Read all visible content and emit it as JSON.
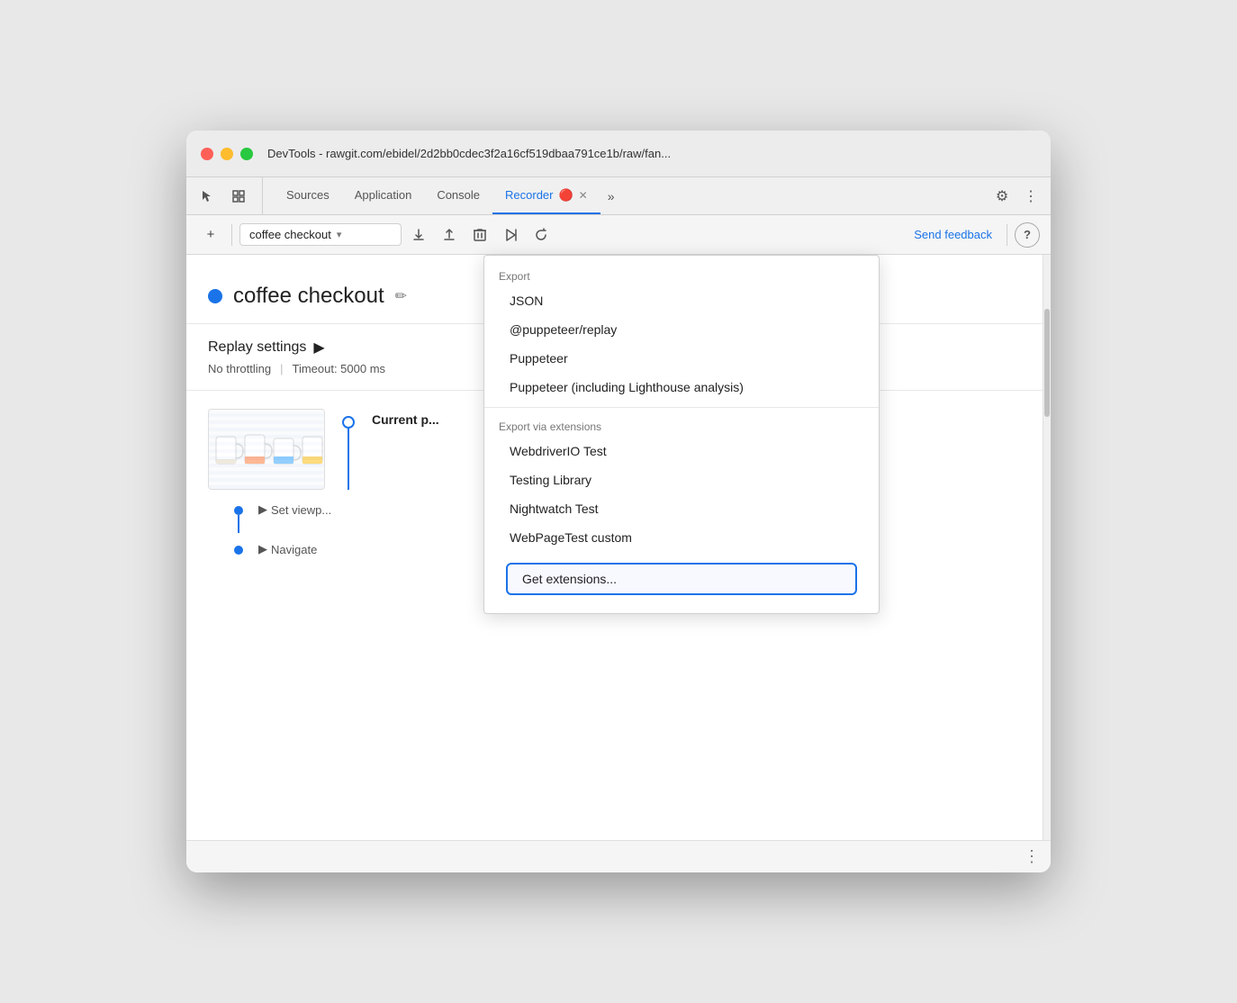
{
  "window": {
    "title": "DevTools - rawgit.com/ebidel/2d2bb0cdec3f2a16cf519dbaa791ce1b/raw/fan...",
    "traffic_lights": [
      "red",
      "yellow",
      "green"
    ]
  },
  "tabs": [
    {
      "id": "sources",
      "label": "Sources",
      "active": false
    },
    {
      "id": "application",
      "label": "Application",
      "active": false
    },
    {
      "id": "console",
      "label": "Console",
      "active": false
    },
    {
      "id": "recorder",
      "label": "Recorder",
      "active": true,
      "closable": true
    }
  ],
  "toolbar": {
    "add_label": "+",
    "recording_name": "coffee checkout",
    "send_feedback_label": "Send feedback",
    "help_label": "?"
  },
  "recording": {
    "dot_color": "#1a73e8",
    "title": "coffee checkout",
    "edit_icon": "✎",
    "replay_settings": {
      "title": "Replay settings",
      "arrow": "▶",
      "no_throttling": "No throttling",
      "timeout": "Timeout: 5000 ms"
    }
  },
  "steps": {
    "current_page_label": "Current p...",
    "set_viewport_label": "Set viewp...",
    "navigate_label": "Navigate",
    "arrow": "▶"
  },
  "dropdown": {
    "export_label": "Export",
    "items": [
      {
        "id": "json",
        "label": "JSON"
      },
      {
        "id": "puppeteer-replay",
        "label": "@puppeteer/replay"
      },
      {
        "id": "puppeteer",
        "label": "Puppeteer"
      },
      {
        "id": "puppeteer-lighthouse",
        "label": "Puppeteer (including Lighthouse analysis)"
      }
    ],
    "export_via_extensions_label": "Export via extensions",
    "extension_items": [
      {
        "id": "webdriverio",
        "label": "WebdriverIO Test"
      },
      {
        "id": "testing-library",
        "label": "Testing Library"
      },
      {
        "id": "nightwatch",
        "label": "Nightwatch Test"
      },
      {
        "id": "webpagetest",
        "label": "WebPageTest custom"
      }
    ],
    "get_extensions_label": "Get extensions..."
  },
  "icons": {
    "cursor": "⬆",
    "layers": "⧉",
    "upload": "↑",
    "download": "↓",
    "trash": "🗑",
    "play": "▶",
    "replay": "↺",
    "chevron_down": "▾",
    "more_vert": "⋮",
    "gear": "⚙",
    "edit_pencil": "✏",
    "arrow_right": "▶",
    "expand_arrow": "▶"
  },
  "colors": {
    "accent": "#1a73e8",
    "text_primary": "#222",
    "text_secondary": "#555",
    "border": "#d0d0d0"
  }
}
